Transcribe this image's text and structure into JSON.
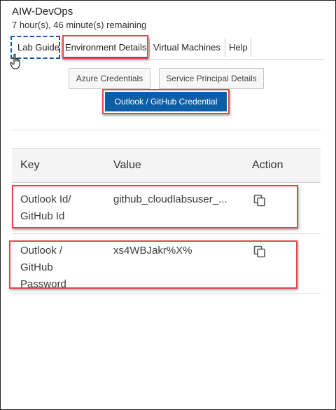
{
  "header": {
    "title": "AIW-DevOps",
    "time_remaining": "7 hour(s), 46 minute(s) remaining"
  },
  "tabs": [
    {
      "label": "Lab Guide"
    },
    {
      "label": "Environment Details"
    },
    {
      "label": "Virtual Machines"
    },
    {
      "label": "Help"
    }
  ],
  "subtabs": {
    "azure_label": "Azure Credentials",
    "sp_label": "Service Principal Details",
    "outlook_label": "Outlook / GitHub Credential"
  },
  "table": {
    "columns": [
      "Key",
      "Value",
      "Action"
    ],
    "rows": [
      {
        "key_lines": [
          "Outlook Id/",
          "GitHub Id"
        ],
        "value": "github_cloudlabsuser_..."
      },
      {
        "key_lines": [
          "Outlook /",
          "GitHub",
          "Password"
        ],
        "value": "xs4WBJakr%X%"
      }
    ]
  },
  "icons": {
    "copy": "copy-icon",
    "cursor": "hand-pointer-icon"
  },
  "colors": {
    "primary": "#0d5ea8",
    "highlight": "#e1484f",
    "focus": "#0f5aa8"
  }
}
